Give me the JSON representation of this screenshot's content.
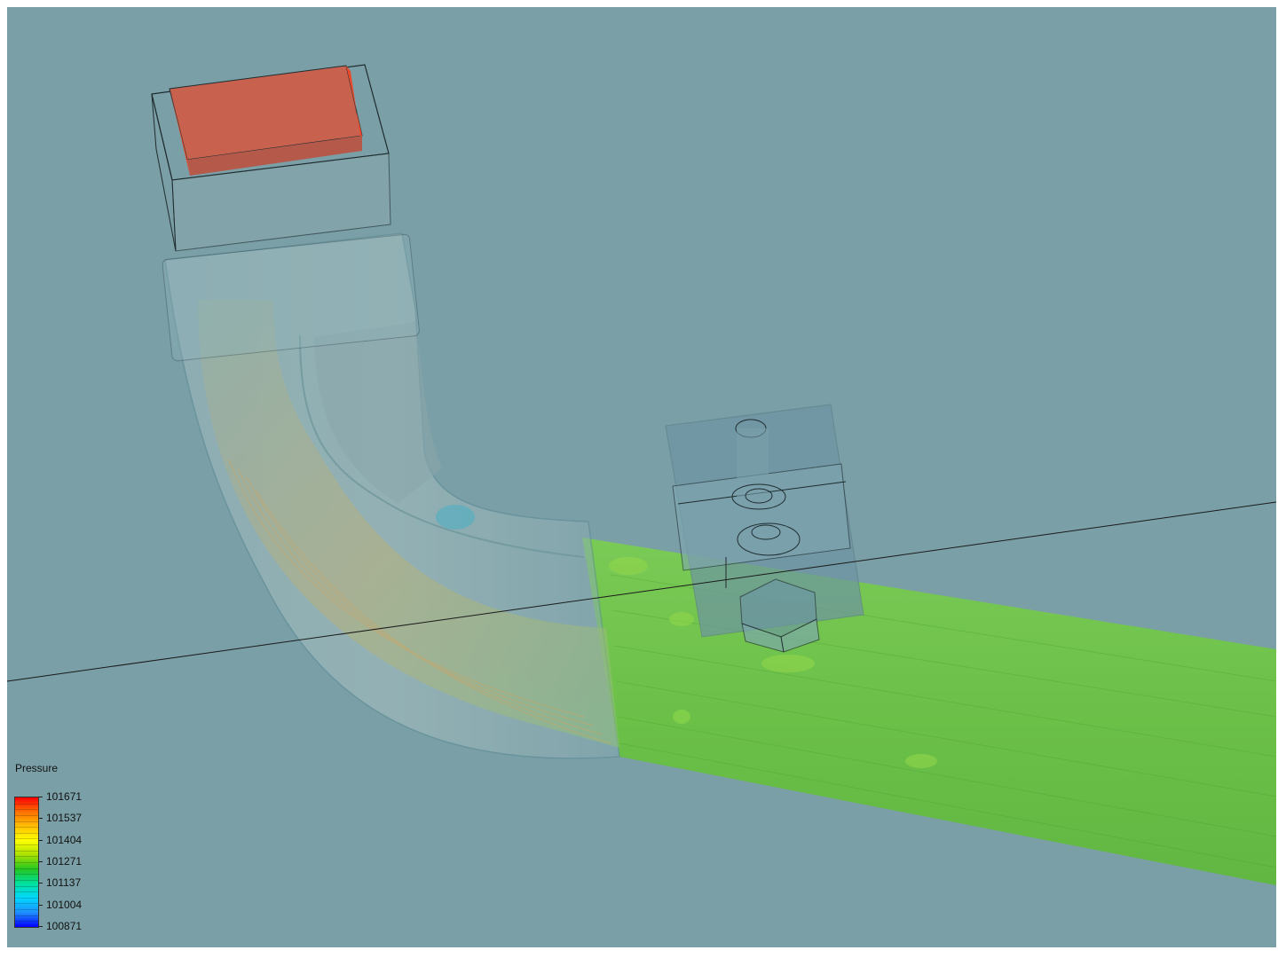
{
  "viewer": {
    "background_color": "#7a9fa6"
  },
  "scene": {
    "objects": [
      {
        "name": "inlet-box",
        "pressure_color": "#c8624f"
      },
      {
        "name": "elbow-duct"
      },
      {
        "name": "outlet-channel",
        "pressure_color": "#6ec24a"
      },
      {
        "name": "sensor-block"
      },
      {
        "name": "hex-nut"
      }
    ]
  },
  "legend": {
    "title": "Pressure",
    "colormap": [
      "#0000ff",
      "#1e90ff",
      "#00d8ff",
      "#00e0a0",
      "#22c822",
      "#a8e000",
      "#ffff00",
      "#ffc000",
      "#ff7000",
      "#ff0000"
    ],
    "labels": [
      "101671",
      "101537",
      "101404",
      "101271",
      "101137",
      "101004",
      "100871"
    ]
  }
}
